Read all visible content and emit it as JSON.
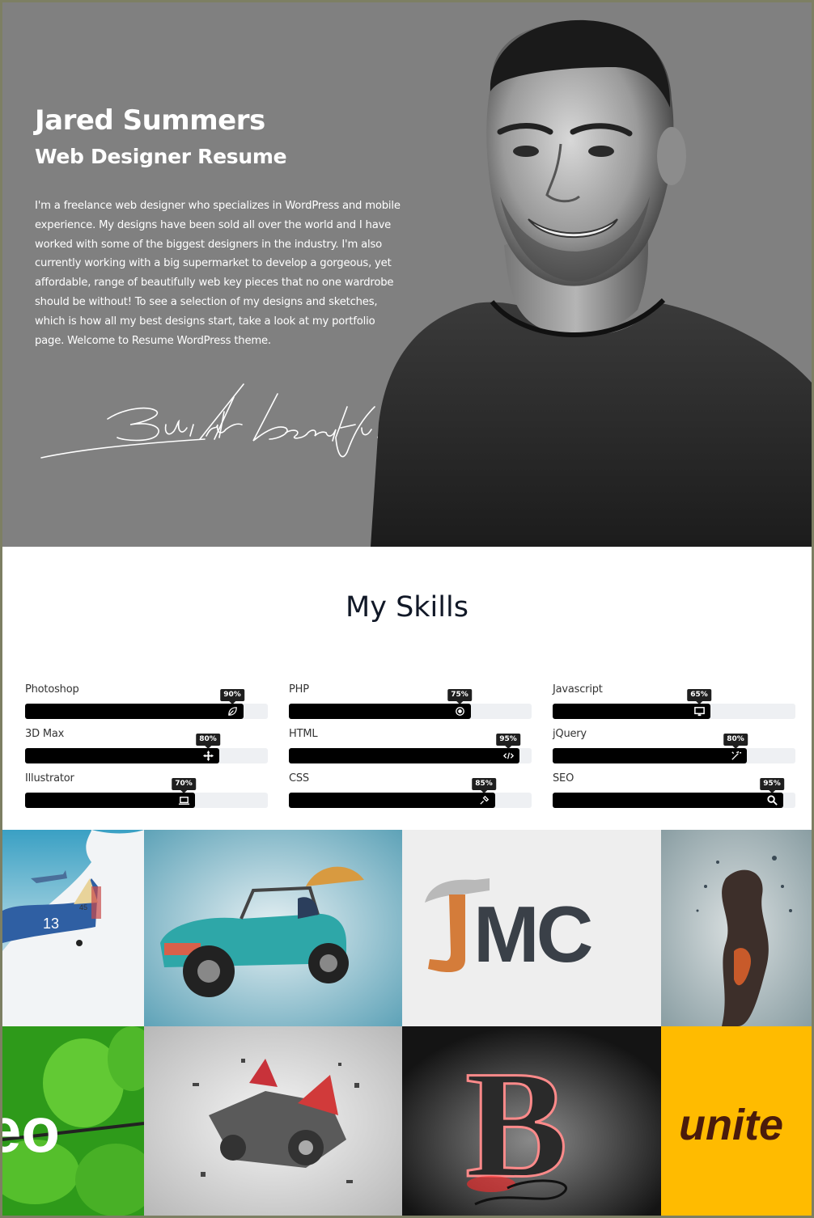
{
  "hero": {
    "name": "Jared Summers",
    "role": "Web Designer Resume",
    "bio": "I'm a freelance web designer who specializes in WordPress and mobile experience. My designs have been sold all over the world and I have worked with some of the biggest designers in the industry. I'm also currently working with a big supermarket to develop a gorgeous, yet affordable, range of beautifully web key pieces that no one wardrobe should be without! To see a selection of my designs and sketches, which is how all my best designs start, take a look at my portfolio page. Welcome to Resume WordPress theme.",
    "signature": "Build it beautiful",
    "portrait_alt": "Portrait photo of Jared Summers"
  },
  "skills": {
    "title": "My Skills",
    "items": [
      {
        "label": "Photoshop",
        "percent": 90,
        "tooltip": "90%",
        "icon": "leaf-icon"
      },
      {
        "label": "PHP",
        "percent": 75,
        "tooltip": "75%",
        "icon": "gear-icon"
      },
      {
        "label": "Javascript",
        "percent": 65,
        "tooltip": "65%",
        "icon": "monitor-icon"
      },
      {
        "label": "3D Max",
        "percent": 80,
        "tooltip": "80%",
        "icon": "move-icon"
      },
      {
        "label": "HTML",
        "percent": 95,
        "tooltip": "95%",
        "icon": "code-icon"
      },
      {
        "label": "jQuery",
        "percent": 80,
        "tooltip": "80%",
        "icon": "magic-wand-icon"
      },
      {
        "label": "Illustrator",
        "percent": 70,
        "tooltip": "70%",
        "icon": "laptop-icon"
      },
      {
        "label": "CSS",
        "percent": 85,
        "tooltip": "85%",
        "icon": "pen-icon"
      },
      {
        "label": "SEO",
        "percent": 95,
        "tooltip": "95%",
        "icon": "search-icon"
      }
    ]
  },
  "portfolio": {
    "items": [
      {
        "name": "airplanes",
        "text": "13",
        "text2": "45"
      },
      {
        "name": "buggy-car",
        "text": ""
      },
      {
        "name": "jmc-logo",
        "text": "MC"
      },
      {
        "name": "splash-figure",
        "text": ""
      },
      {
        "name": "leaf-logo",
        "text": "eo"
      },
      {
        "name": "exploding-car",
        "text": ""
      },
      {
        "name": "neon-b",
        "text": "B"
      },
      {
        "name": "unite-logo",
        "text": "unite"
      }
    ]
  },
  "colors": {
    "hero_bg": "#808080",
    "bar": "#000000",
    "track": "#eef0f3",
    "tooltip": "#1f1f1f",
    "title": "#111827"
  }
}
